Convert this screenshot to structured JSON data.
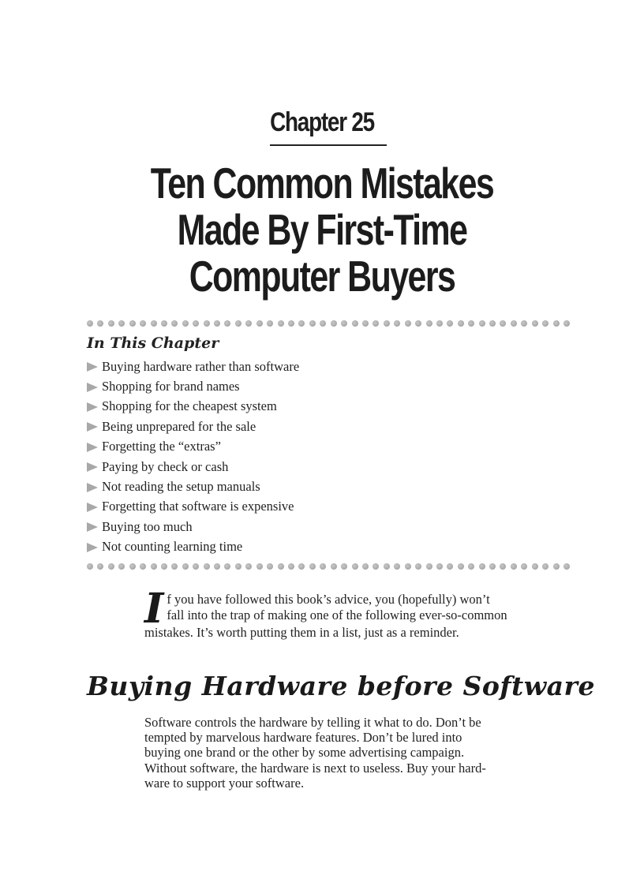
{
  "chapter": {
    "label": "Chapter 25",
    "title_lines": [
      "Ten Common Mistakes",
      "Made By First-Time",
      "Computer Buyers"
    ]
  },
  "in_this_chapter": {
    "heading": "In This Chapter",
    "items": [
      "Buying hardware rather than software",
      "Shopping for brand names",
      "Shopping for the cheapest system",
      "Being unprepared for the sale",
      "Forgetting the “extras”",
      "Paying by check or cash",
      "Not reading the setup manuals",
      "Forgetting that software is expensive",
      "Buying too much",
      "Not counting learning time"
    ]
  },
  "intro": {
    "drop_cap": "I",
    "lines": [
      "f you have followed this book’s advice, you (hopefully) won’t",
      "fall into the trap of making one of the following ever-so-common",
      "mistakes. It’s worth putting them in a list, just as a reminder."
    ]
  },
  "section": {
    "heading": "Buying Hardware before Software",
    "lines": [
      "Software controls the hardware by telling it what to do. Don’t be",
      "tempted by marvelous hardware features. Don’t be lured into",
      "buying one brand or the other by some advertising campaign.",
      "Without software, the hardware is next to useless. Buy your hard-",
      "ware to support your software."
    ]
  }
}
